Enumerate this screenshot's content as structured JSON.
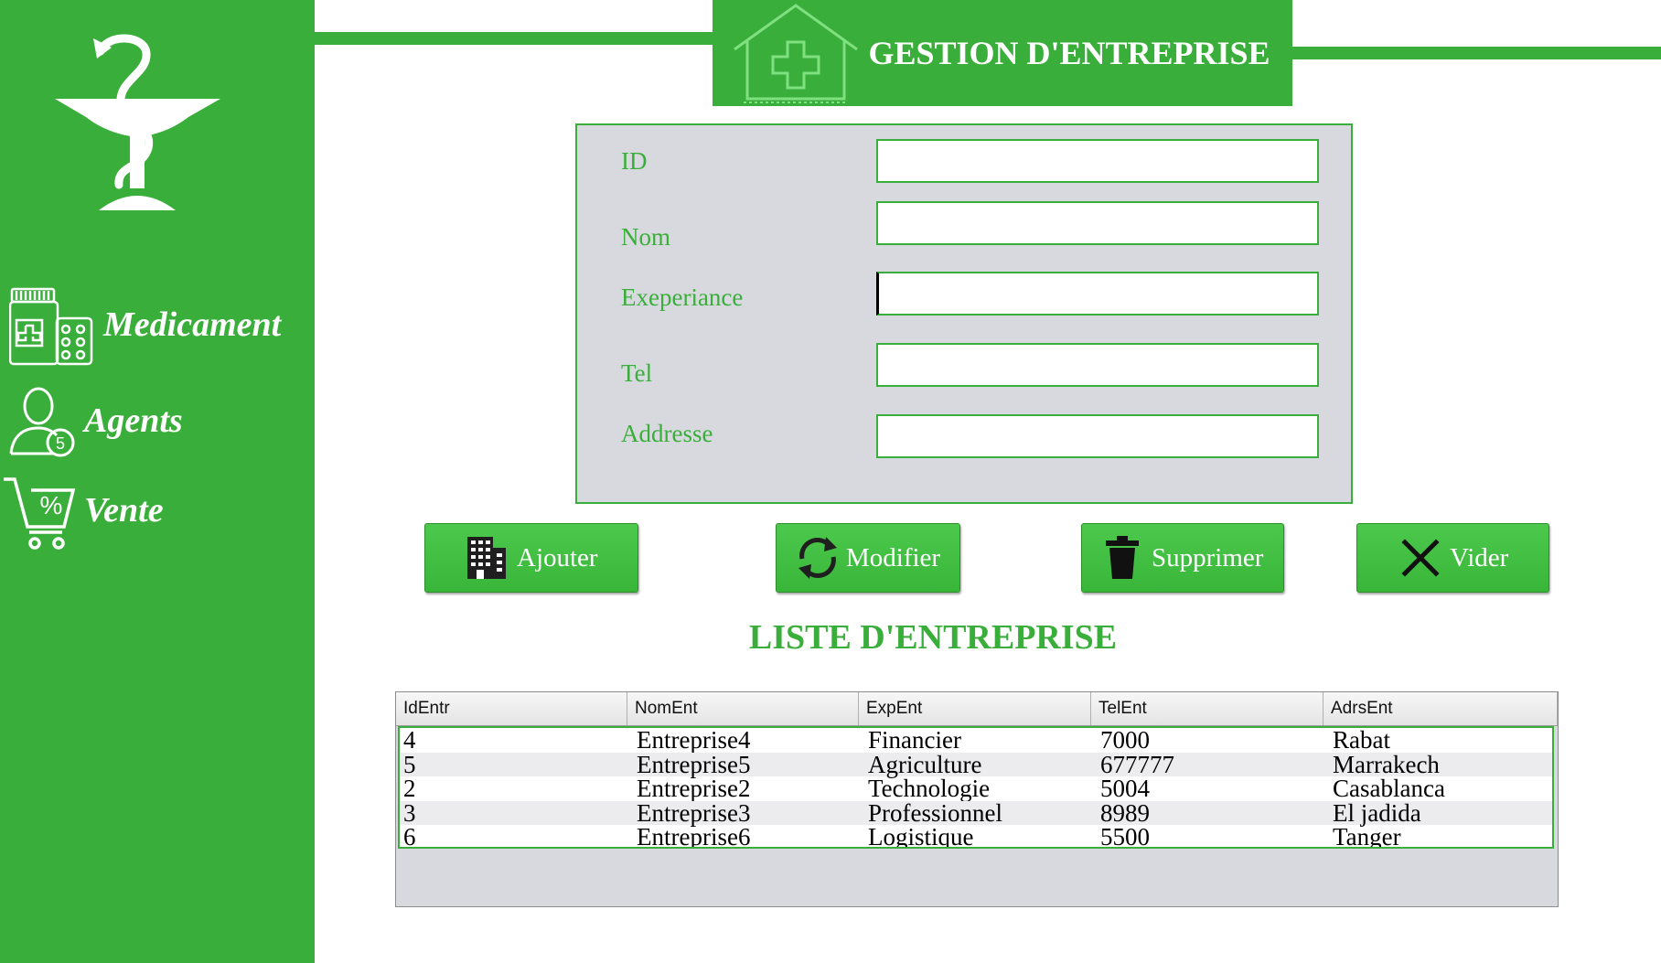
{
  "colors": {
    "brand": "#3aae3a",
    "panel": "#d8d9df",
    "text_on_brand": "#ffffff"
  },
  "sidebar": {
    "logo": "pharmacy-bowl-of-hygieia-icon",
    "items": [
      {
        "label": "Medicament",
        "icon": "medicine-bottle-pills-icon"
      },
      {
        "label": "Agents",
        "icon": "agent-user-icon"
      },
      {
        "label": "Vente",
        "icon": "shopping-cart-percent-icon"
      }
    ]
  },
  "header": {
    "title": "GESTION D'ENTREPRISE",
    "icon": "pharmacy-house-cross-icon"
  },
  "form": {
    "fields": [
      {
        "label": "ID",
        "value": ""
      },
      {
        "label": "Nom",
        "value": ""
      },
      {
        "label": "Exeperiance",
        "value": ""
      },
      {
        "label": "Tel",
        "value": ""
      },
      {
        "label": "Addresse",
        "value": ""
      }
    ]
  },
  "buttons": {
    "add": {
      "label": "Ajouter",
      "icon": "building-icon"
    },
    "edit": {
      "label": "Modifier",
      "icon": "refresh-icon"
    },
    "delete": {
      "label": "Supprimer",
      "icon": "trash-icon"
    },
    "clear": {
      "label": "Vider",
      "icon": "close-x-icon"
    }
  },
  "list": {
    "title": "LISTE D'ENTREPRISE",
    "columns": [
      "IdEntr",
      "NomEnt",
      "ExpEnt",
      "TelEnt",
      "AdrsEnt"
    ],
    "rows": [
      [
        "4",
        "Entreprise4",
        "Financier",
        "7000",
        "Rabat"
      ],
      [
        "5",
        "Entreprise5",
        "Agriculture",
        "677777",
        "Marrakech"
      ],
      [
        "2",
        "Entreprise2",
        "Technologie",
        "5004",
        "Casablanca"
      ],
      [
        "3",
        "Entreprise3",
        "Professionnel",
        "8989",
        "El jadida"
      ],
      [
        "6",
        "Entreprise6",
        "Logistique",
        "5500",
        "Tanger"
      ]
    ]
  }
}
